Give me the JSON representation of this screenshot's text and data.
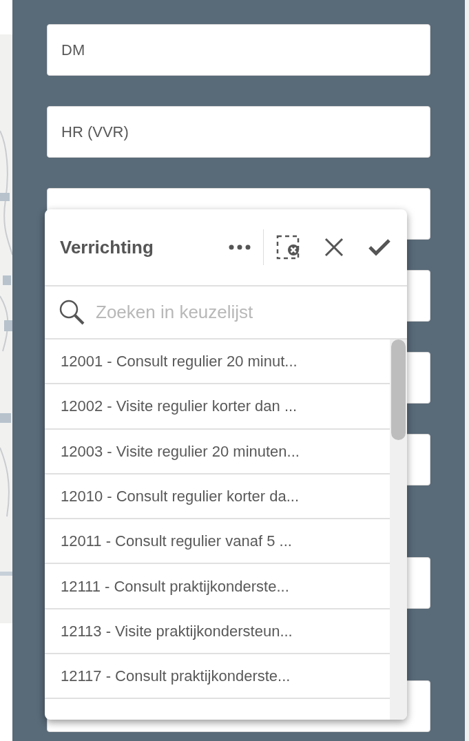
{
  "fields": [
    {
      "value": "DM"
    },
    {
      "value": "HR (VVR)"
    }
  ],
  "listbox": {
    "title": "Verrichting",
    "search": {
      "placeholder": "Zoeken in keuzelijst"
    },
    "items": [
      {
        "text": "12001 - Consult regulier 20 minut..."
      },
      {
        "text": "12002 - Visite regulier korter dan ..."
      },
      {
        "text": "12003 - Visite regulier 20 minuten..."
      },
      {
        "text": "12010 - Consult regulier korter da..."
      },
      {
        "text": "12011 - Consult regulier vanaf 5 ..."
      },
      {
        "text": "12111 - Consult praktijkonderste..."
      },
      {
        "text": "12113 - Visite praktijkondersteun..."
      },
      {
        "text": "12117 - Consult praktijkonderste..."
      }
    ]
  }
}
